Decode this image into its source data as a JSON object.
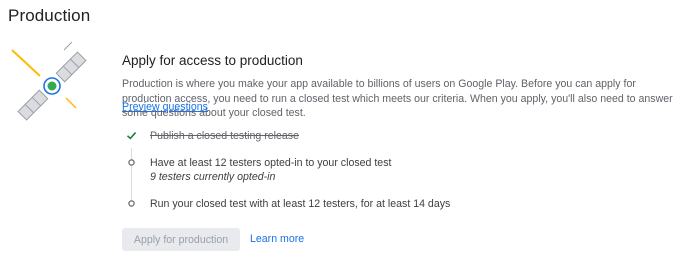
{
  "page": {
    "title": "Production"
  },
  "card": {
    "title": "Apply for access to production",
    "description": "Production is where you make your app available to billions of users on Google Play. Before you can apply for production access, you need to run a closed test which meets our criteria. When you apply, you'll also need to answer some questions about your closed test.",
    "preview_link": "Preview questions"
  },
  "steps": [
    {
      "label": "Publish a closed testing release",
      "status": "done",
      "icon": "check-icon"
    },
    {
      "label": "Have at least 12 testers opted-in to your closed test",
      "sub": "9 testers currently opted-in",
      "status": "pending",
      "icon": "circle-icon"
    },
    {
      "label": "Run your closed test with at least 12 testers, for at least 14 days",
      "status": "pending",
      "icon": "circle-icon"
    }
  ],
  "actions": {
    "apply_label": "Apply for production",
    "learn_more_label": "Learn more"
  },
  "colors": {
    "accent": "#1a73e8",
    "check": "#188038",
    "satellite_dot": "#34a853",
    "satellite_ring": "#1a73e8",
    "ray": "#fbbc04"
  }
}
